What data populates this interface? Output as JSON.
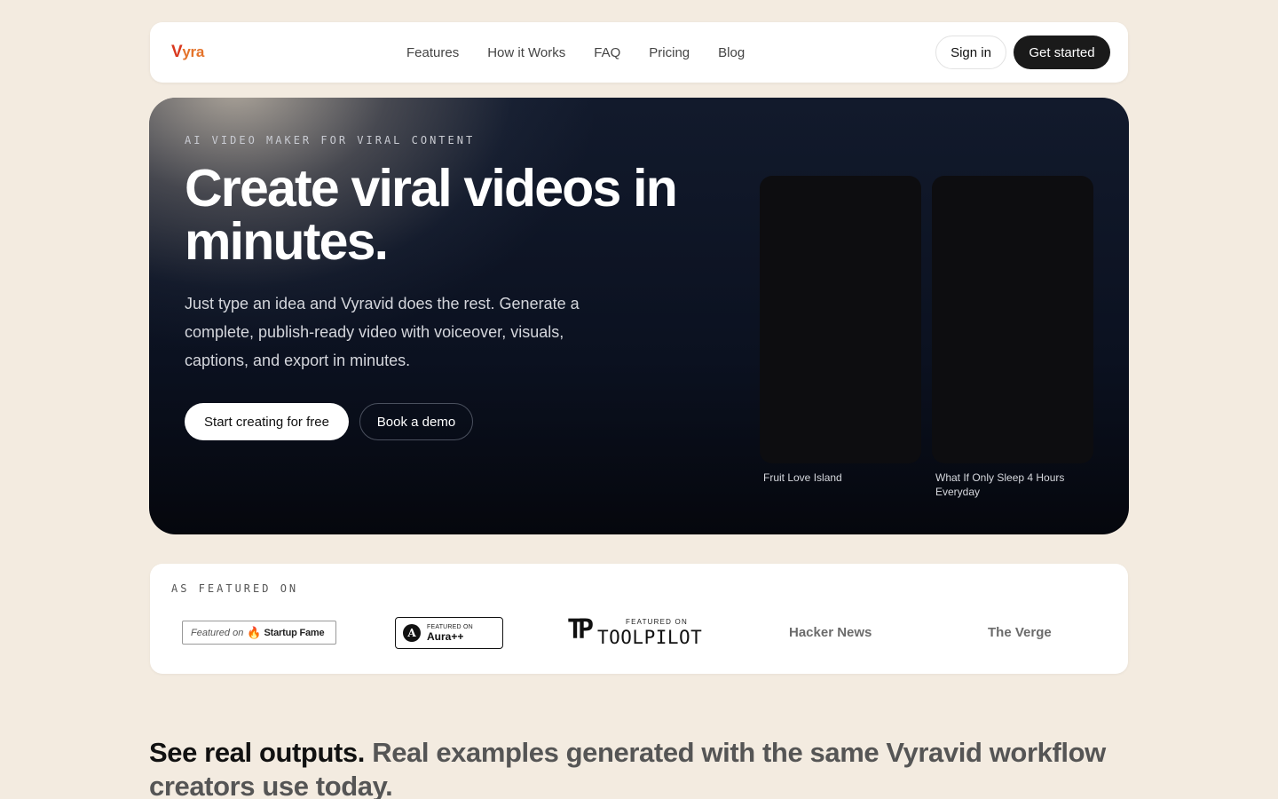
{
  "nav": {
    "logo_first": "V",
    "logo_rest": "yra",
    "links": [
      "Features",
      "How it Works",
      "FAQ",
      "Pricing",
      "Blog"
    ],
    "signin": "Sign in",
    "get_started": "Get started"
  },
  "hero": {
    "eyebrow": "AI VIDEO MAKER FOR VIRAL CONTENT",
    "title": "Create viral videos in minutes.",
    "subtitle": "Just type an idea and Vyravid does the rest. Generate a complete, publish-ready video with voiceover, visuals, captions, and export in minutes.",
    "cta_primary": "Start creating for free",
    "cta_secondary": "Book a demo",
    "videos": [
      {
        "caption": "Fruit Love Island"
      },
      {
        "caption": "What If Only Sleep 4 Hours Everyday"
      }
    ]
  },
  "featured": {
    "label": "AS FEATURED ON",
    "startup_fame": {
      "prefix": "Featured on",
      "name": "Startup Fame"
    },
    "aura": {
      "small": "FEATURED ON",
      "name": "Aura++",
      "mark": "A"
    },
    "toolpilot": {
      "small": "FEATURED ON",
      "mark": "TP",
      "name": "TOOLPILOT"
    },
    "hacker_news": "Hacker News",
    "the_verge": "The Verge"
  },
  "outputs": {
    "strong": "See real outputs.",
    "rest": "Real examples generated with the same Vyravid workflow creators use today."
  },
  "colors": {
    "page_bg": "#f3ebe0",
    "hero_bg": "#0b1120",
    "logo_accent": "#e4732a",
    "primary_button": "#1a1a1a"
  }
}
